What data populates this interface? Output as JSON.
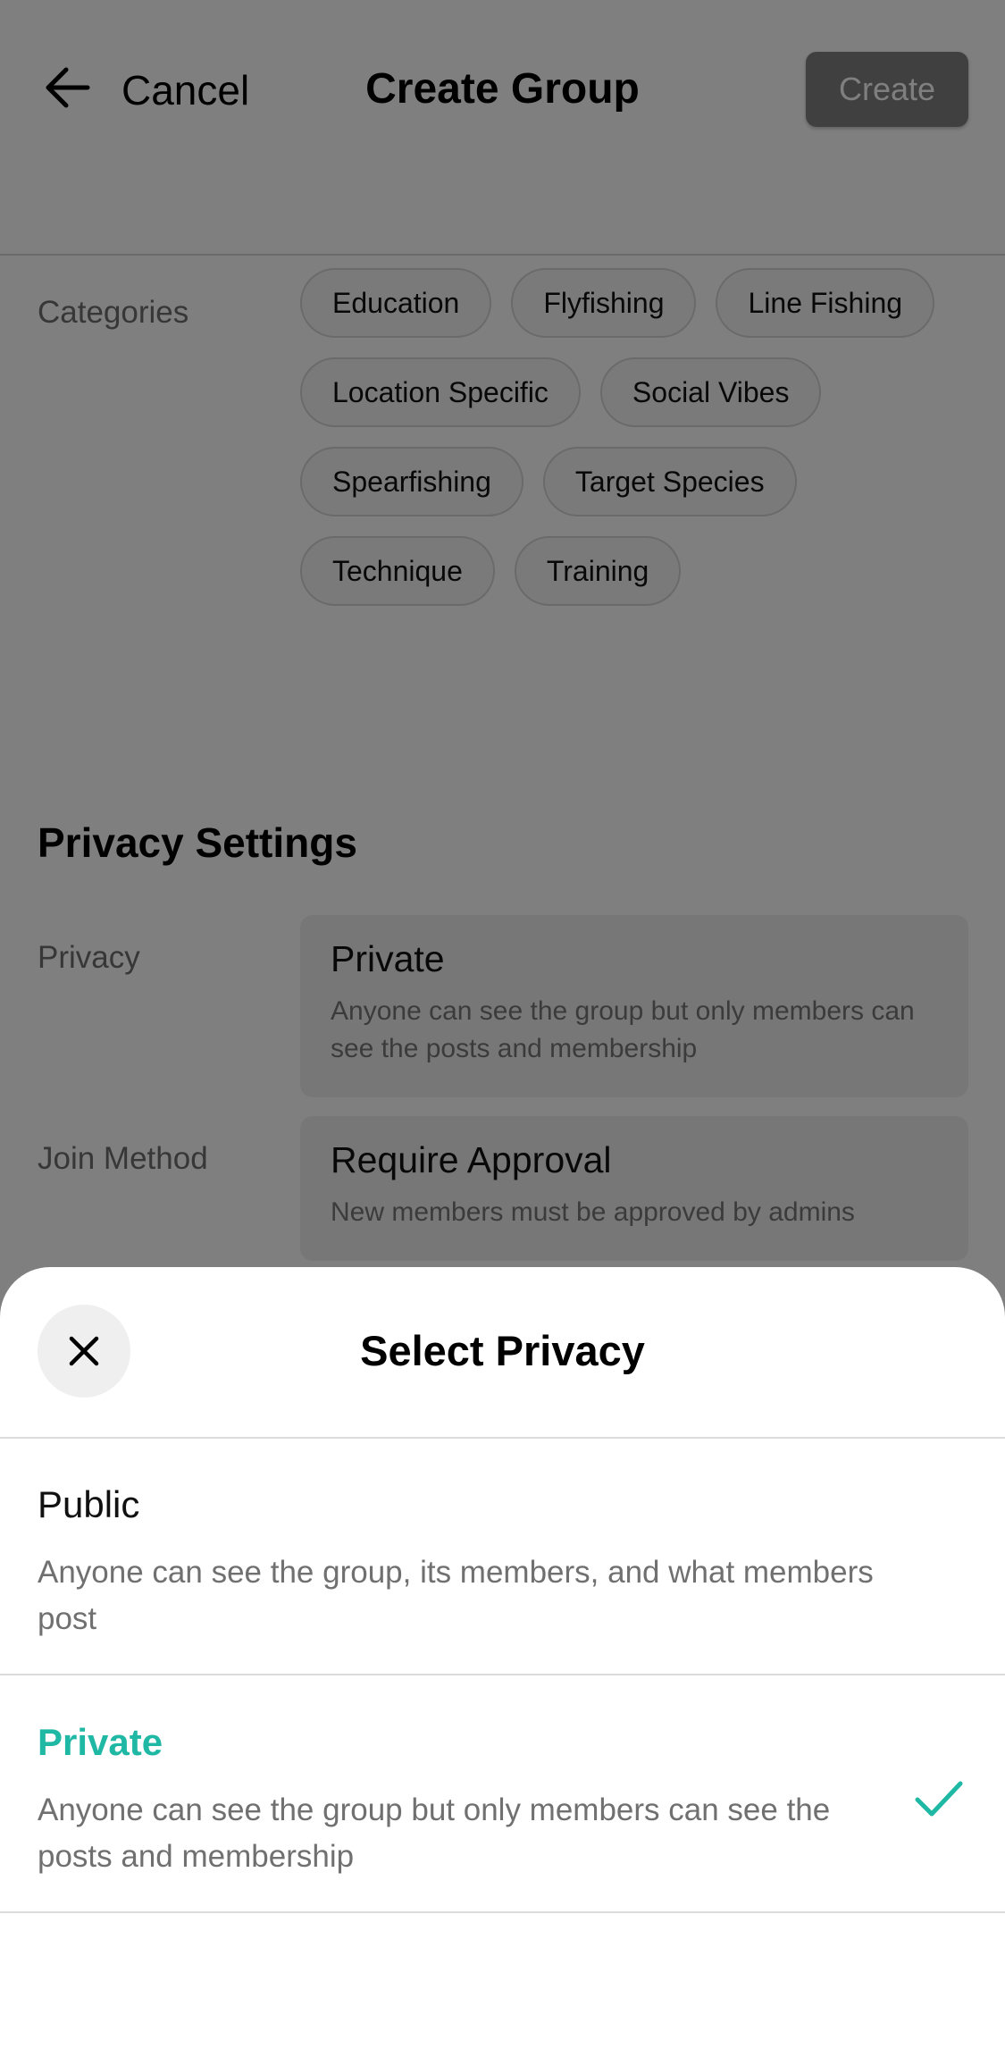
{
  "header": {
    "cancel_label": "Cancel",
    "title": "Create Group",
    "create_label": "Create",
    "back_icon": "arrow-left-icon"
  },
  "categories": {
    "label": "Categories",
    "chips": [
      "Education",
      "Flyfishing",
      "Line Fishing",
      "Location Specific",
      "Social Vibes",
      "Spearfishing",
      "Target Species",
      "Technique",
      "Training"
    ]
  },
  "privacy_settings": {
    "title": "Privacy Settings",
    "privacy": {
      "label": "Privacy",
      "value": "Private",
      "description": "Anyone can see the group but only members can see the posts and membership"
    },
    "join_method": {
      "label": "Join Method",
      "value": "Require Approval",
      "description": "New members must be approved by admins"
    }
  },
  "sheet": {
    "title": "Select Privacy",
    "close_icon": "close-icon",
    "options": [
      {
        "title": "Public",
        "description": "Anyone can see the group, its members, and what members post",
        "selected": false
      },
      {
        "title": "Private",
        "description": "Anyone can see the group but only members can see the posts and membership",
        "selected": true
      }
    ],
    "check_icon": "checkmark-icon"
  },
  "colors": {
    "accent": "#1fb8a4",
    "overlay": "rgba(0,0,0,0.5)"
  }
}
